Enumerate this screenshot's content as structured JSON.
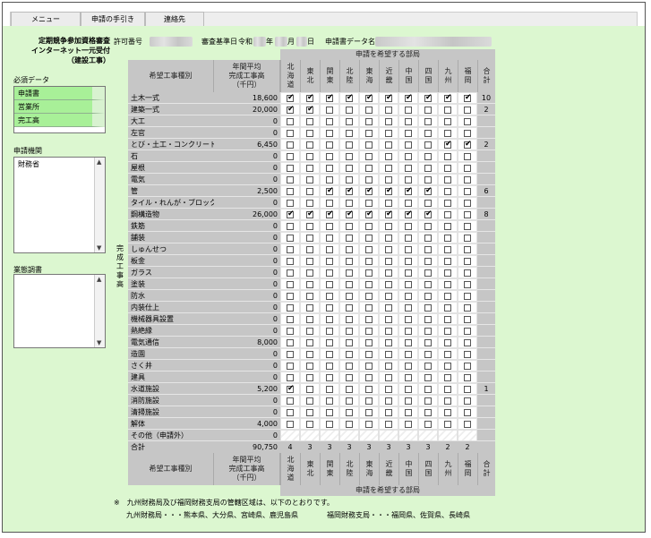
{
  "menu": {
    "tabs": [
      "メニュー",
      "申請の手引き",
      "連絡先"
    ]
  },
  "title": {
    "lines": [
      "定期競争参加資格審査",
      "インターネット一元受付",
      "（建設工事）"
    ]
  },
  "info": {
    "permit_label": "許可番号",
    "criteria_label": "審査基準日",
    "era": "令和",
    "year_unit": "年",
    "month_unit": "月",
    "day_unit": "日",
    "datafile_label": "申請書データ名"
  },
  "left": {
    "required_label": "必須データ",
    "required_items": [
      "申請書",
      "営業所",
      "完工高"
    ],
    "agency_label": "申請機関",
    "agency_items": [
      "財務省"
    ],
    "survey_label": "業態調書"
  },
  "table": {
    "dept_header": "申請を希望する部局",
    "type_header": "希望工事種別",
    "amount_header": [
      "年間平均",
      "完成工事高",
      "（千円）"
    ],
    "side_label": [
      "完",
      "成",
      "工",
      "事",
      "高"
    ],
    "regions": [
      "北海道",
      "東北",
      "関東",
      "北陸",
      "東海",
      "近畿",
      "中国",
      "四国",
      "九州",
      "福岡"
    ],
    "total_header": "合計",
    "rows": [
      {
        "name": "土木一式",
        "amount": "18,600",
        "checks": [
          1,
          1,
          1,
          1,
          1,
          1,
          1,
          1,
          1,
          1
        ],
        "total": "10"
      },
      {
        "name": "建築一式",
        "amount": "20,000",
        "checks": [
          1,
          1,
          0,
          0,
          0,
          0,
          0,
          0,
          0,
          0
        ],
        "total": "2"
      },
      {
        "name": "大工",
        "amount": "0",
        "checks": [
          0,
          0,
          0,
          0,
          0,
          0,
          0,
          0,
          0,
          0
        ],
        "total": ""
      },
      {
        "name": "左官",
        "amount": "0",
        "checks": [
          0,
          0,
          0,
          0,
          0,
          0,
          0,
          0,
          0,
          0
        ],
        "total": ""
      },
      {
        "name": "とび・土工・コンクリート",
        "amount": "6,450",
        "checks": [
          0,
          0,
          0,
          0,
          0,
          0,
          0,
          0,
          1,
          1
        ],
        "total": "2"
      },
      {
        "name": "石",
        "amount": "0",
        "checks": [
          0,
          0,
          0,
          0,
          0,
          0,
          0,
          0,
          0,
          0
        ],
        "total": ""
      },
      {
        "name": "屋根",
        "amount": "0",
        "checks": [
          0,
          0,
          0,
          0,
          0,
          0,
          0,
          0,
          0,
          0
        ],
        "total": ""
      },
      {
        "name": "電気",
        "amount": "0",
        "checks": [
          0,
          0,
          0,
          0,
          0,
          0,
          0,
          0,
          0,
          0
        ],
        "total": ""
      },
      {
        "name": "管",
        "amount": "2,500",
        "checks": [
          0,
          0,
          1,
          1,
          1,
          1,
          1,
          1,
          0,
          0
        ],
        "total": "6"
      },
      {
        "name": "タイル・れんが・ブロック",
        "amount": "0",
        "checks": [
          0,
          0,
          0,
          0,
          0,
          0,
          0,
          0,
          0,
          0
        ],
        "total": ""
      },
      {
        "name": "鋼構造物",
        "amount": "26,000",
        "checks": [
          1,
          1,
          1,
          1,
          1,
          1,
          1,
          1,
          0,
          0
        ],
        "total": "8"
      },
      {
        "name": "鉄筋",
        "amount": "0",
        "checks": [
          0,
          0,
          0,
          0,
          0,
          0,
          0,
          0,
          0,
          0
        ],
        "total": ""
      },
      {
        "name": "舗装",
        "amount": "0",
        "checks": [
          0,
          0,
          0,
          0,
          0,
          0,
          0,
          0,
          0,
          0
        ],
        "total": ""
      },
      {
        "name": "しゅんせつ",
        "amount": "0",
        "checks": [
          0,
          0,
          0,
          0,
          0,
          0,
          0,
          0,
          0,
          0
        ],
        "total": ""
      },
      {
        "name": "板金",
        "amount": "0",
        "checks": [
          0,
          0,
          0,
          0,
          0,
          0,
          0,
          0,
          0,
          0
        ],
        "total": ""
      },
      {
        "name": "ガラス",
        "amount": "0",
        "checks": [
          0,
          0,
          0,
          0,
          0,
          0,
          0,
          0,
          0,
          0
        ],
        "total": ""
      },
      {
        "name": "塗装",
        "amount": "0",
        "checks": [
          0,
          0,
          0,
          0,
          0,
          0,
          0,
          0,
          0,
          0
        ],
        "total": ""
      },
      {
        "name": "防水",
        "amount": "0",
        "checks": [
          0,
          0,
          0,
          0,
          0,
          0,
          0,
          0,
          0,
          0
        ],
        "total": ""
      },
      {
        "name": "内装仕上",
        "amount": "0",
        "checks": [
          0,
          0,
          0,
          0,
          0,
          0,
          0,
          0,
          0,
          0
        ],
        "total": ""
      },
      {
        "name": "機械器具設置",
        "amount": "0",
        "checks": [
          0,
          0,
          0,
          0,
          0,
          0,
          0,
          0,
          0,
          0
        ],
        "total": ""
      },
      {
        "name": "熱絶縁",
        "amount": "0",
        "checks": [
          0,
          0,
          0,
          0,
          0,
          0,
          0,
          0,
          0,
          0
        ],
        "total": ""
      },
      {
        "name": "電気通信",
        "amount": "8,000",
        "checks": [
          0,
          0,
          0,
          0,
          0,
          0,
          0,
          0,
          0,
          0
        ],
        "total": ""
      },
      {
        "name": "造園",
        "amount": "0",
        "checks": [
          0,
          0,
          0,
          0,
          0,
          0,
          0,
          0,
          0,
          0
        ],
        "total": ""
      },
      {
        "name": "さく井",
        "amount": "0",
        "checks": [
          0,
          0,
          0,
          0,
          0,
          0,
          0,
          0,
          0,
          0
        ],
        "total": ""
      },
      {
        "name": "建具",
        "amount": "0",
        "checks": [
          0,
          0,
          0,
          0,
          0,
          0,
          0,
          0,
          0,
          0
        ],
        "total": ""
      },
      {
        "name": "水道施設",
        "amount": "5,200",
        "checks": [
          1,
          0,
          0,
          0,
          0,
          0,
          0,
          0,
          0,
          0
        ],
        "total": "1"
      },
      {
        "name": "消防施設",
        "amount": "0",
        "checks": [
          0,
          0,
          0,
          0,
          0,
          0,
          0,
          0,
          0,
          0
        ],
        "total": ""
      },
      {
        "name": "清掃施設",
        "amount": "0",
        "checks": [
          0,
          0,
          0,
          0,
          0,
          0,
          0,
          0,
          0,
          0
        ],
        "total": ""
      },
      {
        "name": "解体",
        "amount": "4,000",
        "checks": [
          0,
          0,
          0,
          0,
          0,
          0,
          0,
          0,
          0,
          0
        ],
        "total": ""
      },
      {
        "name": "その他（申請外）",
        "amount": "0",
        "checks": null,
        "total": ""
      }
    ],
    "total_row": {
      "name": "合計",
      "amount": "90,750",
      "counts": [
        "4",
        "3",
        "3",
        "3",
        "3",
        "3",
        "3",
        "3",
        "2",
        "2"
      ],
      "total": ""
    }
  },
  "note": {
    "lines": [
      "※　九州財務局及び福岡財務支局の管轄区域は、以下のとおりです。",
      "九州財務局・・・熊本県、大分県、宮崎県、鹿児島県　　　　福岡財務支局・・・福岡県、佐賀県、長崎県"
    ]
  }
}
